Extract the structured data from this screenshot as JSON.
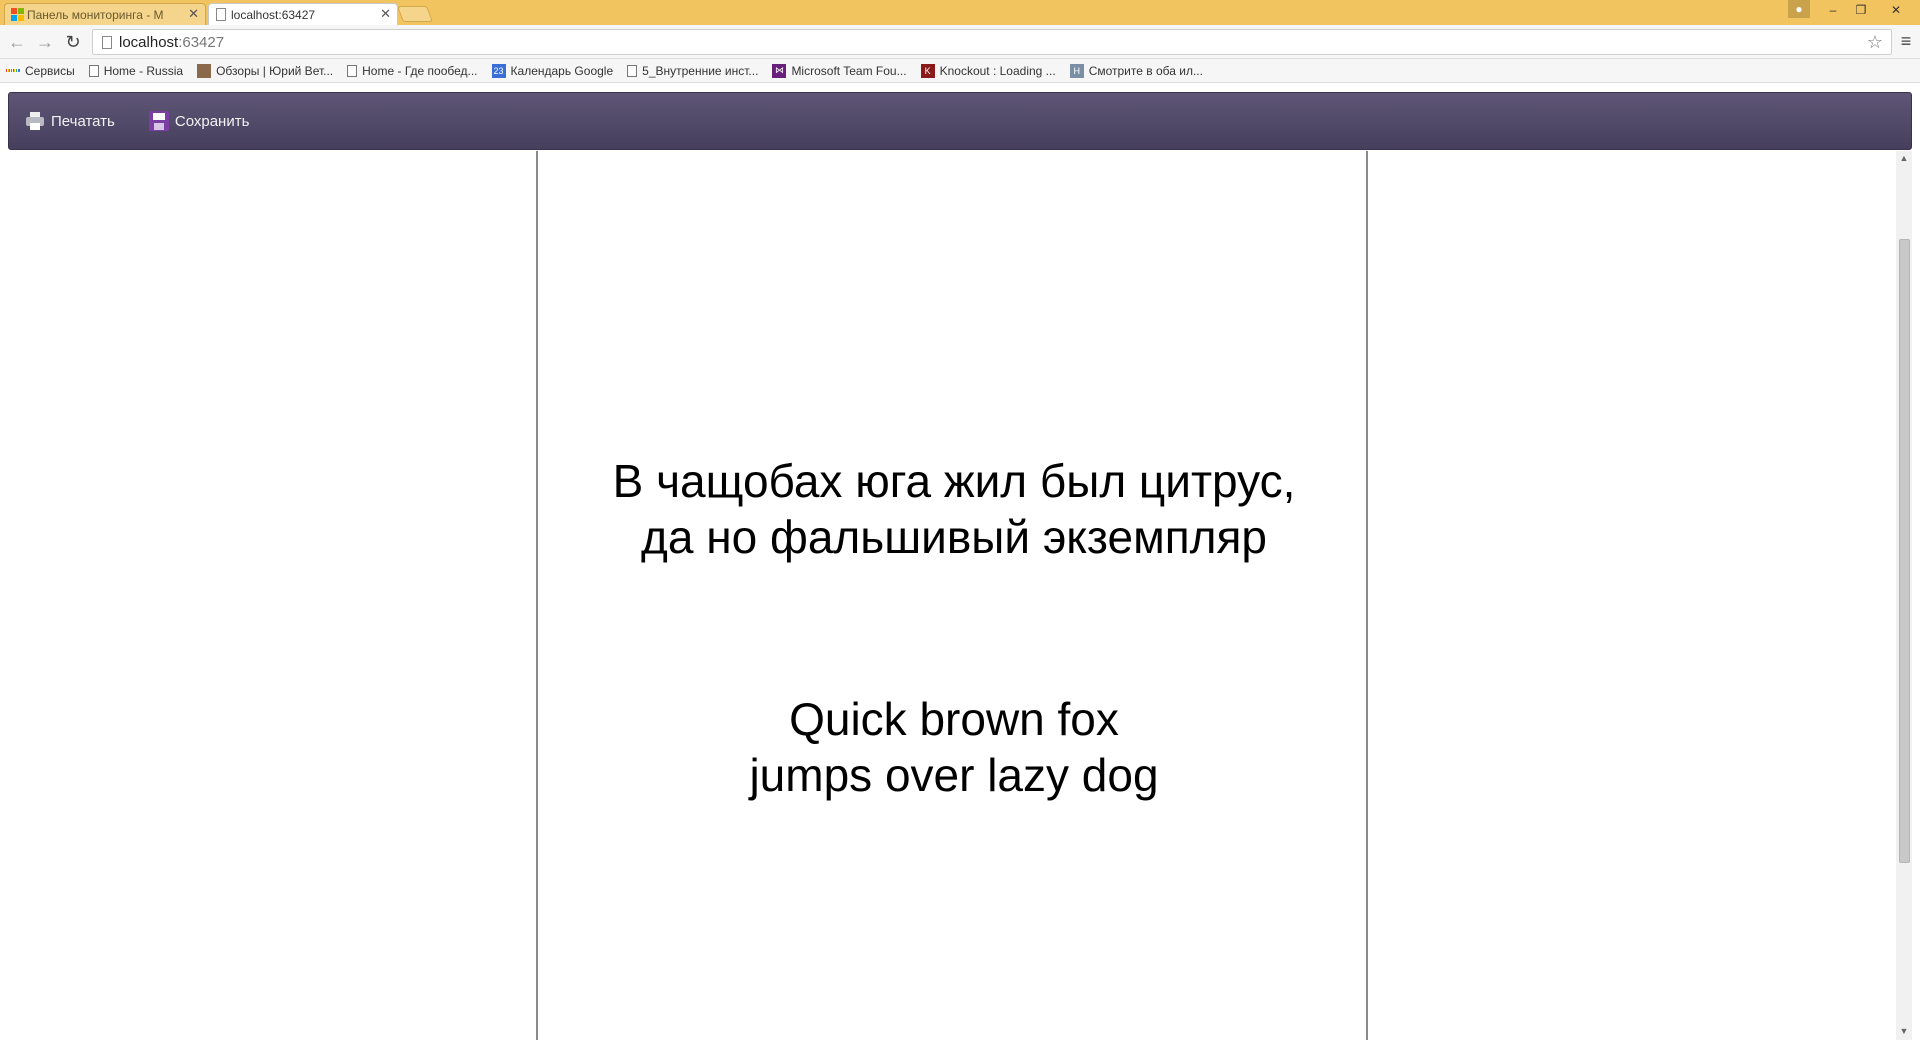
{
  "browser": {
    "tabs": [
      {
        "title": "Панель мониторинга - M",
        "active": false
      },
      {
        "title": "localhost:63427",
        "active": true
      }
    ],
    "close_glyph": "✕",
    "window_controls": {
      "minimize": "‒",
      "restore": "❐",
      "close": "✕"
    },
    "address": {
      "host": "localhost",
      "port": ":63427"
    },
    "bookmarks": [
      {
        "label": "Сервисы",
        "icon": "apps-grid-icon"
      },
      {
        "label": "Home - Russia",
        "icon": "page-icon"
      },
      {
        "label": "Обзоры | Юрий Вет...",
        "icon": "photo-icon"
      },
      {
        "label": "Home - Где пообед...",
        "icon": "page-icon"
      },
      {
        "label": "Календарь Google",
        "icon": "calendar-icon",
        "icon_text": "23"
      },
      {
        "label": "5_Внутренние инст...",
        "icon": "page-icon"
      },
      {
        "label": "Microsoft Team Fou...",
        "icon": "visual-studio-icon"
      },
      {
        "label": "Knockout : Loading ...",
        "icon": "knockout-icon"
      },
      {
        "label": "Смотрите в оба ил...",
        "icon": "habr-icon",
        "icon_text": "H"
      }
    ]
  },
  "app_toolbar": {
    "print_label": "Печатать",
    "save_label": "Сохранить"
  },
  "document": {
    "block_ru": [
      "В чащобах юга жил был цитрус,",
      "да но фальшивый экземпляр"
    ],
    "block_en": [
      "Quick brown fox",
      "jumps over lazy dog"
    ]
  },
  "colors": {
    "tabstrip": "#f2c45f",
    "app_toolbar": "#4f4867",
    "save_icon": "#7b3fa3"
  }
}
